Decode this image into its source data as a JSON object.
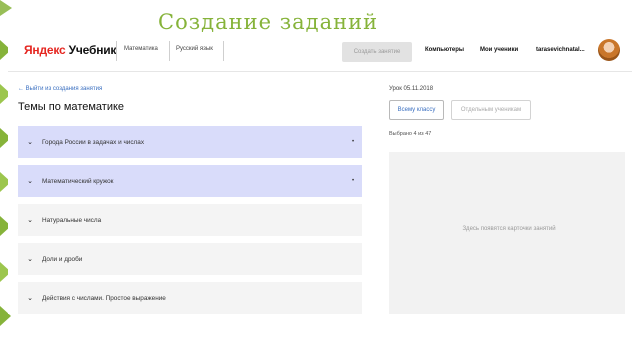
{
  "slide": {
    "title": "Создание заданий"
  },
  "header": {
    "logo_brand": "Яндекс",
    "logo_product": "Учебник",
    "subjects": [
      "Математика",
      "Русский язык"
    ],
    "create_button": "Создать занятие",
    "links": [
      "Компьютеры",
      "Мои ученики"
    ],
    "user_name": "tarasevichnatal..."
  },
  "left": {
    "back_link": "← Выйти из создания занятия",
    "title": "Темы по математике",
    "topics": [
      {
        "label": "Города России в задачах и числах",
        "state": "active",
        "marker": "•"
      },
      {
        "label": "Математический кружок",
        "state": "active",
        "marker": "•"
      },
      {
        "label": "Натуральные числа",
        "state": "plain",
        "marker": ""
      },
      {
        "label": "Доли и дроби",
        "state": "plain",
        "marker": ""
      },
      {
        "label": "Действия с числами. Простое выражение",
        "state": "plain",
        "marker": ""
      }
    ]
  },
  "right": {
    "lesson": "Урок 05.11.2018",
    "tabs": [
      "Всему классу",
      "Отдельным ученикам"
    ],
    "selected_count": "Выбрано 4 из 47",
    "cards_hint": "Здесь появятся карточки занятий"
  },
  "colors": {
    "accent_green": "#86b33a",
    "topic_active": "#d9dcfa",
    "link_blue": "#3a6fc0"
  }
}
